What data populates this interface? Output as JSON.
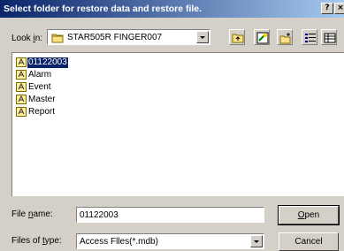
{
  "window": {
    "title": "Select folder for restore data and restore file.",
    "help_label": "?",
    "close_label": "×"
  },
  "lookin": {
    "label_accel": "i",
    "label_rest": "n:",
    "label_pre": "Look ",
    "value": "STAR505R FINGER007"
  },
  "toolbar": {
    "icons": [
      "up-folder-icon",
      "desktop-icon",
      "new-folder-icon",
      "list-view-icon",
      "details-view-icon"
    ]
  },
  "files": [
    {
      "name": "01122003",
      "selected": true
    },
    {
      "name": "Alarm",
      "selected": false
    },
    {
      "name": "Event",
      "selected": false
    },
    {
      "name": "Master",
      "selected": false
    },
    {
      "name": "Report",
      "selected": false
    }
  ],
  "filename": {
    "label_pre": "File ",
    "label_accel": "n",
    "label_rest": "ame:",
    "value": "01122003"
  },
  "filetype": {
    "label_pre": "Files of ",
    "label_accel": "t",
    "label_rest": "ype:",
    "value": "Access Flles(*.mdb)"
  },
  "buttons": {
    "open_accel": "O",
    "open_rest": "pen",
    "cancel": "Cancel"
  },
  "colors": {
    "titlebar_start": "#0a246a",
    "titlebar_end": "#a6caf0",
    "dialog_bg": "#d4d0c8",
    "selection": "#0a246a"
  }
}
